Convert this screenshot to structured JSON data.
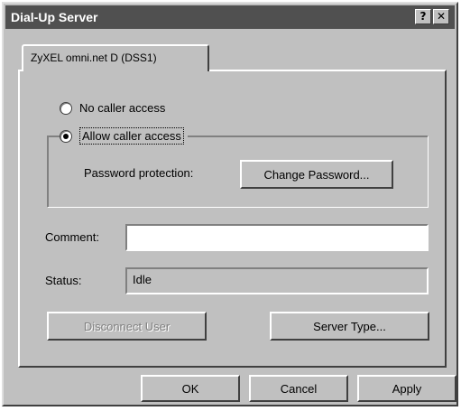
{
  "window": {
    "title": "Dial-Up Server"
  },
  "titlebar": {
    "help_label": "?",
    "close_label": "✕"
  },
  "tab": {
    "label": "ZyXEL omni.net D (DSS1)"
  },
  "access": {
    "no_access_label": "No caller access",
    "allow_access_label": "Allow caller access",
    "selected": "allow"
  },
  "password": {
    "label": "Password protection:",
    "button_label": "Change Password..."
  },
  "comment": {
    "label": "Comment:",
    "value": ""
  },
  "status": {
    "label": "Status:",
    "value": "Idle"
  },
  "buttons": {
    "disconnect_label": "Disconnect User",
    "server_type_label": "Server Type...",
    "ok_label": "OK",
    "cancel_label": "Cancel",
    "apply_label": "Apply"
  }
}
